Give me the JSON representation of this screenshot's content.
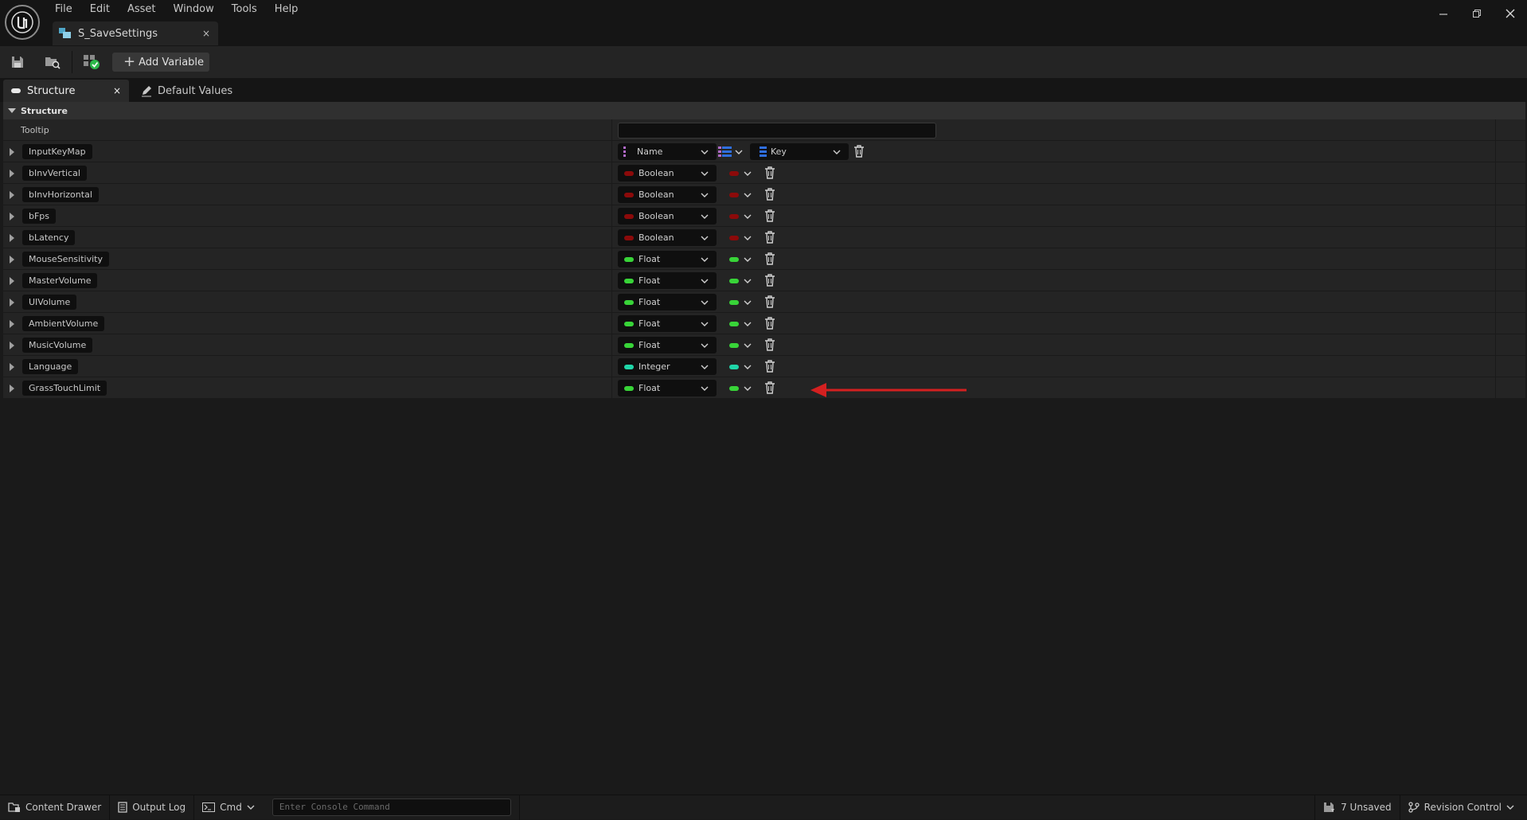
{
  "menu": [
    "File",
    "Edit",
    "Asset",
    "Window",
    "Tools",
    "Help"
  ],
  "document_tab": {
    "title": "S_SaveSettings",
    "close": "×"
  },
  "toolbar": {
    "add_variable": "Add Variable"
  },
  "panel_tabs": {
    "structure": "Structure",
    "structure_close": "×",
    "default_values": "Default Values"
  },
  "section": {
    "title": "Structure"
  },
  "tooltip_row": {
    "label": "Tooltip",
    "value": ""
  },
  "map_row": {
    "name": "InputKeyMap",
    "key_type": "Name",
    "value_type": "Key",
    "key_color": "#b16ac8",
    "value_color": "#2f6fe0"
  },
  "rows": [
    {
      "name": "bInvVertical",
      "type": "Boolean",
      "color": "#8c0a0a"
    },
    {
      "name": "bInvHorizontal",
      "type": "Boolean",
      "color": "#8c0a0a"
    },
    {
      "name": "bFps",
      "type": "Boolean",
      "color": "#8c0a0a"
    },
    {
      "name": "bLatency",
      "type": "Boolean",
      "color": "#8c0a0a"
    },
    {
      "name": "MouseSensitivity",
      "type": "Float",
      "color": "#38d438"
    },
    {
      "name": "MasterVolume",
      "type": "Float",
      "color": "#38d438"
    },
    {
      "name": "UIVolume",
      "type": "Float",
      "color": "#38d438"
    },
    {
      "name": "AmbientVolume",
      "type": "Float",
      "color": "#38d438"
    },
    {
      "name": "MusicVolume",
      "type": "Float",
      "color": "#38d438"
    },
    {
      "name": "Language",
      "type": "Integer",
      "color": "#1fd6a8"
    },
    {
      "name": "GrassTouchLimit",
      "type": "Float",
      "color": "#38d438"
    }
  ],
  "statusbar": {
    "content_drawer": "Content Drawer",
    "output_log": "Output Log",
    "cmd": "Cmd",
    "console_placeholder": "Enter Console Command",
    "unsaved": "7 Unsaved",
    "revision_control": "Revision Control"
  },
  "colors": {
    "accent_arrow": "#d42020"
  }
}
